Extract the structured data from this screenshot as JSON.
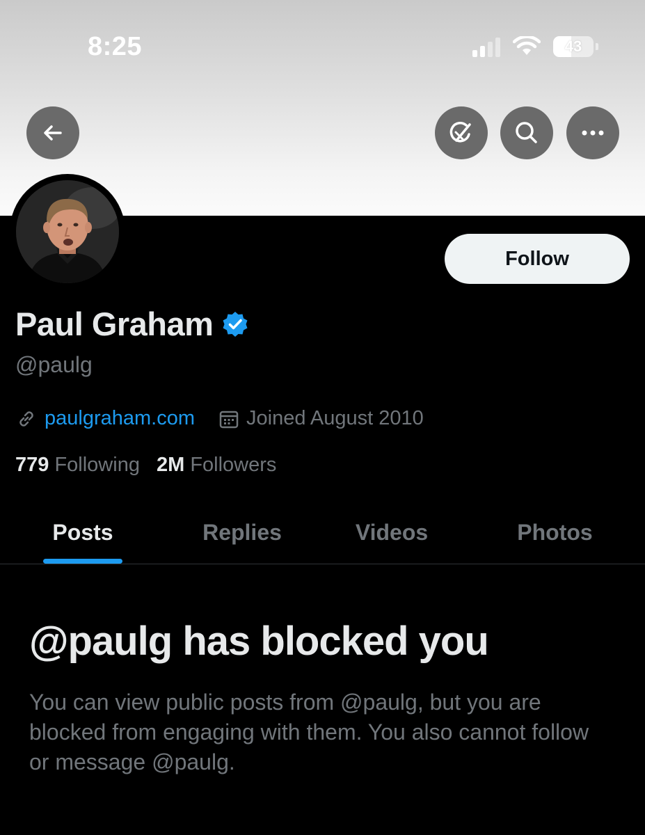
{
  "status_bar": {
    "time": "8:25",
    "battery": "43"
  },
  "header": {
    "back_icon": "arrow-left-icon",
    "actions": [
      "grok-icon",
      "search-icon",
      "more-horizontal-icon"
    ]
  },
  "profile": {
    "name": "Paul Graham",
    "handle": "@paulg",
    "verified": true,
    "website": "paulgraham.com",
    "joined": "Joined August 2010",
    "following_count": "779",
    "following_label": "Following",
    "followers_count": "2M",
    "followers_label": "Followers",
    "follow_label": "Follow"
  },
  "tabs": [
    {
      "label": "Posts",
      "active": true
    },
    {
      "label": "Replies",
      "active": false
    },
    {
      "label": "Videos",
      "active": false
    },
    {
      "label": "Photos",
      "active": false
    }
  ],
  "blocked": {
    "title": "@paulg has blocked you",
    "body": "You can view public posts from @paulg, but you are blocked from engaging with them. You also cannot follow or message @paulg."
  },
  "colors": {
    "accent": "#1d9bf0",
    "background": "#000000",
    "text_primary": "#e7e9ea",
    "text_secondary": "#71767b"
  }
}
